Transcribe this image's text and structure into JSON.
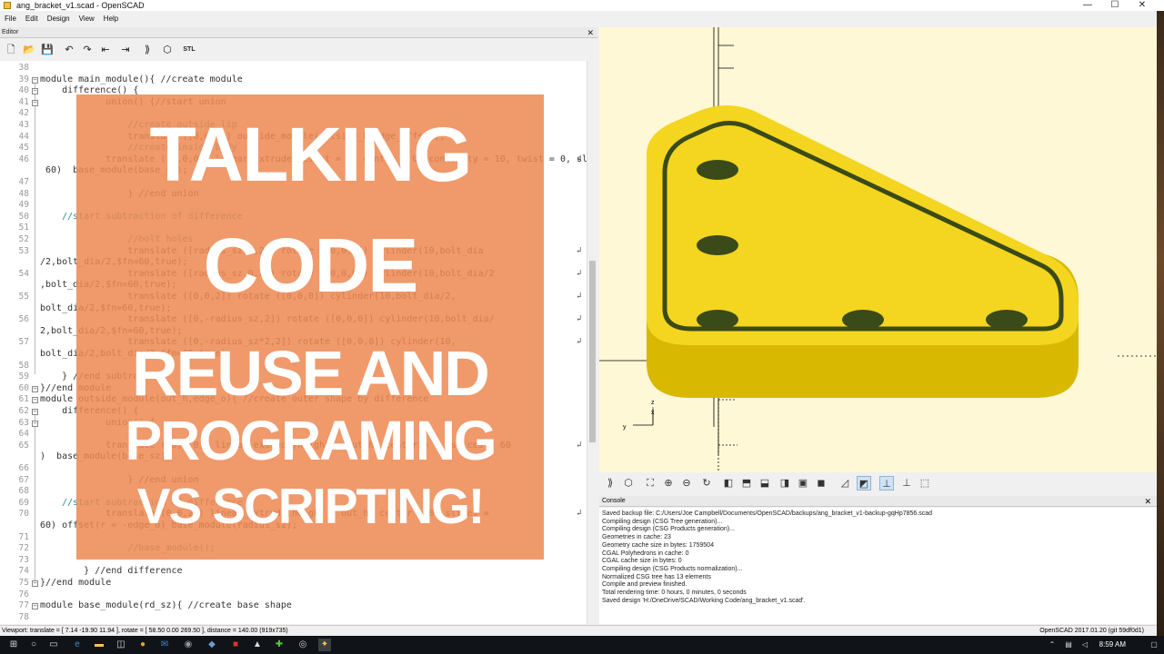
{
  "window": {
    "title": "ang_bracket_v1.scad - OpenSCAD",
    "minimize": "—",
    "maximize": "☐",
    "close": "✕"
  },
  "menu": [
    "File",
    "Edit",
    "Design",
    "View",
    "Help"
  ],
  "editor": {
    "panel_title": "Editor",
    "lines": [
      {
        "n": "38",
        "t": ""
      },
      {
        "n": "39",
        "t": "module main_module(){ //create module"
      },
      {
        "n": "40",
        "t": "    difference() {"
      },
      {
        "n": "41",
        "t": "            union() {//start union"
      },
      {
        "n": "42",
        "t": ""
      },
      {
        "n": "43",
        "t": "                //create outside lip"
      },
      {
        "n": "44",
        "t": "                translate ([0,0,0]) outside_module(outside_h,edge_offset);"
      },
      {
        "n": "45",
        "t": "                //create inside body"
      },
      {
        "n": "46",
        "t": "            translate ([0,0,0]) linear_extrude(height = 4, center = 0, convexity = 10, twist = 0, slices ="
      },
      {
        "n": "",
        "t": " 60)  base_module(base_sz);"
      },
      {
        "n": "47",
        "t": ""
      },
      {
        "n": "48",
        "t": "                } //end union"
      },
      {
        "n": "49",
        "t": ""
      },
      {
        "n": "50",
        "t": "    //start subtraction of difference"
      },
      {
        "n": "51",
        "t": ""
      },
      {
        "n": "52",
        "t": "                //bolt holes"
      },
      {
        "n": "53",
        "t": "                translate ([radius_sz,0,2]) rotate ([0,0,0]) cylinder(10,bolt_dia"
      },
      {
        "n": "",
        "t": "/2,bolt_dia/2,$fn=60,true);"
      },
      {
        "n": "54",
        "t": "                translate ([radius_sz,0,2]) rotate ([0,0,0]) cylinder(10,bolt_dia/2"
      },
      {
        "n": "",
        "t": ",bolt_dia/2,$fn=60,true);"
      },
      {
        "n": "55",
        "t": "                translate ([0,0,2]) rotate ([0,0,0]) cylinder(10,bolt_dia/2,"
      },
      {
        "n": "",
        "t": "bolt_dia/2,$fn=60,true);"
      },
      {
        "n": "56",
        "t": "                translate ([0,-radius_sz,2]) rotate ([0,0,0]) cylinder(10,bolt_dia/"
      },
      {
        "n": "",
        "t": "2,bolt_dia/2,$fn=60,true);"
      },
      {
        "n": "57",
        "t": "                translate ([0,-radius_sz*2,2]) rotate ([0,0,0]) cylinder(10,"
      },
      {
        "n": "",
        "t": "bolt_dia/2,bolt_dia/2,$fn=60,true);"
      },
      {
        "n": "58",
        "t": ""
      },
      {
        "n": "59",
        "t": "    } //end subtraction"
      },
      {
        "n": "60",
        "t": "}//end module"
      },
      {
        "n": "61",
        "t": "module outside_module(out_h,edge_o){ //create outer shape by difference"
      },
      {
        "n": "62",
        "t": "    difference() {"
      },
      {
        "n": "63",
        "t": "            union() {"
      },
      {
        "n": "64",
        "t": ""
      },
      {
        "n": "65",
        "t": "            translate ([0,0,0]) linear_extrude(height = out_h, center = 0, slices = 60"
      },
      {
        "n": "",
        "t": ")  base_module(base_sz);"
      },
      {
        "n": "66",
        "t": ""
      },
      {
        "n": "67",
        "t": "                } //end union"
      },
      {
        "n": "68",
        "t": ""
      },
      {
        "n": "69",
        "t": "    //start subtraction of difference"
      },
      {
        "n": "70",
        "t": "            translate([0,0,2]) linear_extrude(height = out_h, center = 0, slices ="
      },
      {
        "n": "",
        "t": "60) offset(r = -edge_o) base_module(radius_sz);"
      },
      {
        "n": "71",
        "t": ""
      },
      {
        "n": "72",
        "t": "                //base_module();"
      },
      {
        "n": "73",
        "t": ""
      },
      {
        "n": "74",
        "t": "        } //end difference"
      },
      {
        "n": "75",
        "t": "}//end module"
      },
      {
        "n": "76",
        "t": ""
      },
      {
        "n": "77",
        "t": "module base_module(rd_sz){ //create base shape"
      },
      {
        "n": "78",
        "t": ""
      }
    ]
  },
  "overlay": {
    "line1": "TALKING",
    "line2": "CODE",
    "line3": "REUSE AND",
    "line4": "PROGRAMING",
    "line5": "VS SCRIPTING!"
  },
  "viewport": {
    "axis_x": "x",
    "axis_y": "y",
    "axis_z": "z",
    "part_color": "#f4d51f",
    "part_side_color": "#d8b800",
    "hole_color": "#3a4a18",
    "background": "#fff8d6"
  },
  "console": {
    "panel_title": "Console",
    "lines": [
      "Saved backup file: C:/Users/Joe Campbell/Documents/OpenSCAD/backups/ang_bracket_v1-backup-gqHp7856.scad",
      "Compiling design (CSG Tree generation)...",
      "Compiling design (CSG Products generation)...",
      "Geometries in cache: 23",
      "Geometry cache size in bytes: 1759504",
      "CGAL Polyhedrons in cache: 0",
      "CGAL cache size in bytes: 0",
      "Compiling design (CSG Products normalization)...",
      "Normalized CSG tree has 13 elements",
      "Compile and preview finished.",
      "Total rendering time: 0 hours, 0 minutes, 0 seconds",
      "Saved design 'H:/OneDrive/SCAD/Working Code/ang_bracket_v1.scad'."
    ]
  },
  "status": {
    "left": "Viewport: translate = [ 7.14 -19.90 11.94 ], rotate = [ 58.50 0.00 269.50 ], distance = 140.00 (919x735)",
    "right": "OpenSCAD 2017.01.20 (git 59df0d1)"
  },
  "taskbar": {
    "clock": "8:59 AM"
  }
}
